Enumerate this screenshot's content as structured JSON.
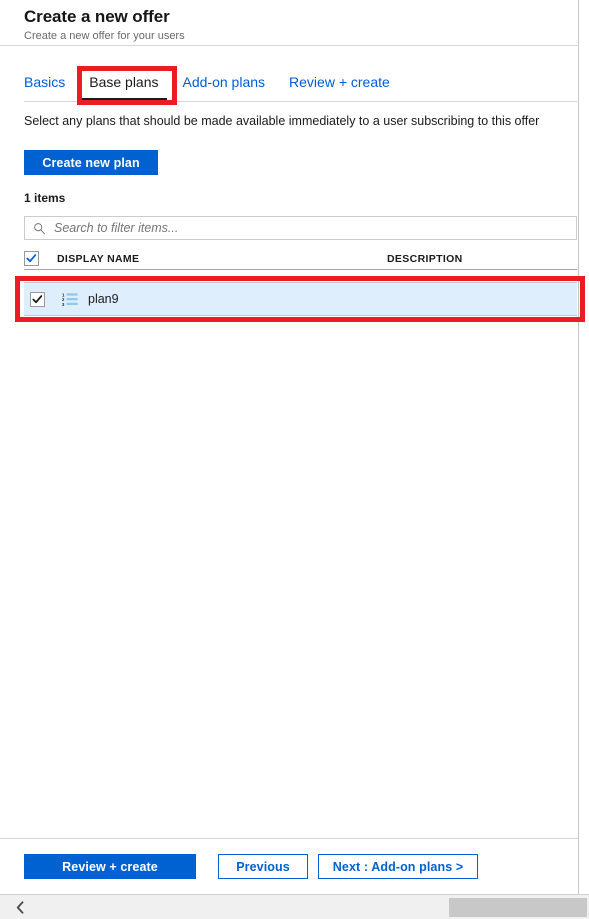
{
  "header": {
    "title": "Create a new offer",
    "subtitle": "Create a new offer for your users"
  },
  "tabs": [
    {
      "label": "Basics",
      "active": false
    },
    {
      "label": "Base plans",
      "active": true
    },
    {
      "label": "Add-on plans",
      "active": false
    },
    {
      "label": "Review + create",
      "active": false
    }
  ],
  "main": {
    "intro": "Select any plans that should be made available immediately to a user subscribing to this offer",
    "create_plan_label": "Create new plan",
    "items_count": "1 items",
    "search": {
      "placeholder": "Search to filter items...",
      "value": "",
      "icon": "search-icon"
    },
    "table": {
      "columns": [
        "DISPLAY NAME",
        "DESCRIPTION"
      ],
      "header_checkbox_checked": true,
      "rows": [
        {
          "checked": true,
          "icon": "numbered-list-icon",
          "display_name": "plan9",
          "description": ""
        }
      ]
    }
  },
  "footer": {
    "review_create_label": "Review + create",
    "previous_label": "Previous",
    "next_label": "Next : Add-on plans >"
  },
  "scrollbar": {
    "back_icon": "chevron-left-icon"
  },
  "colors": {
    "accent_blue": "#0062d1",
    "link_blue": "#015cda",
    "row_selected_bg": "#deeefc",
    "annotation_red": "#ec1c24"
  }
}
